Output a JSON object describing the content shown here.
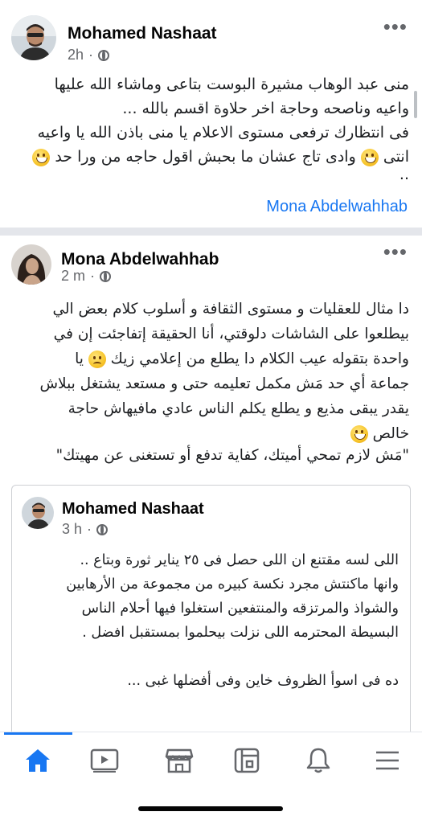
{
  "post1": {
    "author": "Mohamed Nashaat",
    "time": "2h",
    "more": "•••",
    "lines": [
      "منى عبد الوهاب مشيرة البوست بتاعى وماشاء الله عليها",
      "واعيه وناصحه وحاجة اخر حلاوة اقسم بالله ...",
      "فى انتظارك ترفعى مستوى الاعلام يا منى باذن الله يا واعيه",
      "انتى",
      "وادى تاج عشان ما بحبش اقول حاجه من ورا حد",
      ".."
    ],
    "tag": "Mona Abdelwahhab"
  },
  "post2": {
    "author": "Mona Abdelwahhab",
    "time": "2 m",
    "more": "•••",
    "lines": [
      "دا مثال للعقليات و مستوى الثقافة و أسلوب كلام بعض الي",
      "بيطلعوا على الشاشات دلوقتي، أنا الحقيقة إتفاجئت إن في",
      "واحدة بتقوله عيب الكلام دا يطلع من إعلامي زيك",
      "يا",
      "جماعة أي حد مَش مكمل تعليمه حتى و مستعد يشتغل ببلاش",
      "يقدر يبقى مذيع و يطلع يكلم الناس عادي مافيهاش حاجة",
      "خالص",
      "\"مَش لازم تمحي أميتك، كفاية تدفع أو تستغنى عن مهيتك\""
    ]
  },
  "shared": {
    "author": "Mohamed Nashaat",
    "time": "3 h",
    "lines": [
      "اللى لسه مقتنع ان اللى حصل فى ٢٥ يناير ثورة وبتاع ..",
      "وانها ماكنتش مجرد نكسة كبيره من مجموعة من الأرهابين",
      "والشواذ والمرتزقه والمنتفعين استغلوا فيها أحلام الناس",
      "البسيطة المحترمه اللى نزلت بيحلموا بمستقبل افضل .",
      "ده فى اسوأ الظروف خاين وفى أفضلها غبى ..."
    ]
  },
  "nav": {
    "items": [
      "home-icon",
      "video-icon",
      "marketplace-icon",
      "feeds-icon",
      "notifications-icon",
      "menu-icon"
    ],
    "accent": "#1877f2",
    "inactive": "#65676b"
  }
}
